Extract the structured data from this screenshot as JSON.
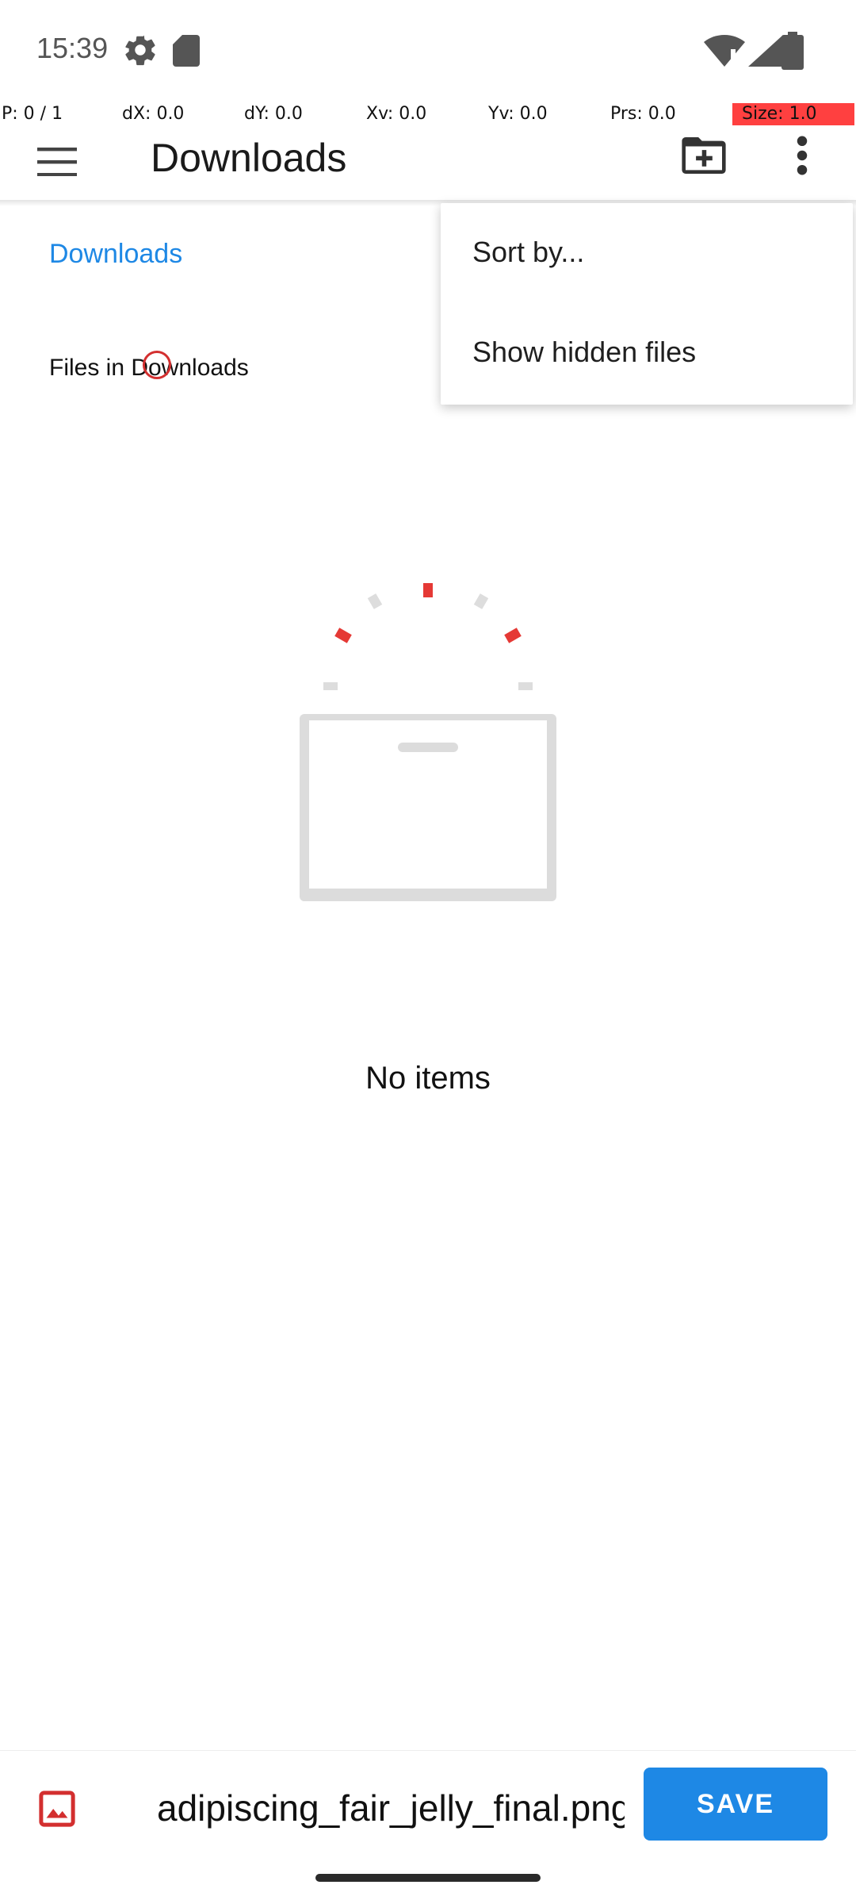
{
  "status_bar": {
    "time": "15:39",
    "icons": [
      "gear-icon",
      "sd-card-icon",
      "wifi-icon",
      "signal-icon",
      "battery-icon"
    ]
  },
  "pointer_overlay": {
    "p": "P: 0 / 1",
    "dx": "dX: 0.0",
    "dy": "dY: 0.0",
    "xv": "Xv: 0.0",
    "yv": "Yv: 0.0",
    "prs": "Prs: 0.0",
    "size": "Size: 1.0",
    "size_color": "#ff4040"
  },
  "toolbar": {
    "title": "Downloads",
    "menu_icon": "hamburger-icon",
    "new_folder_icon": "new-folder-icon",
    "overflow_icon": "more-vert-icon"
  },
  "breadcrumb": {
    "label": "Downloads"
  },
  "section": {
    "header": "Files in Downloads"
  },
  "overflow_menu": {
    "items": [
      {
        "label": "Sort by..."
      },
      {
        "label": "Show hidden files"
      }
    ]
  },
  "empty_state": {
    "text": "No items"
  },
  "bottom_bar": {
    "mime_icon": "image-icon",
    "filename_value": "adipiscing_fair_jelly_final.png",
    "save_label": "SAVE",
    "accent_color": "#1e88e5"
  }
}
